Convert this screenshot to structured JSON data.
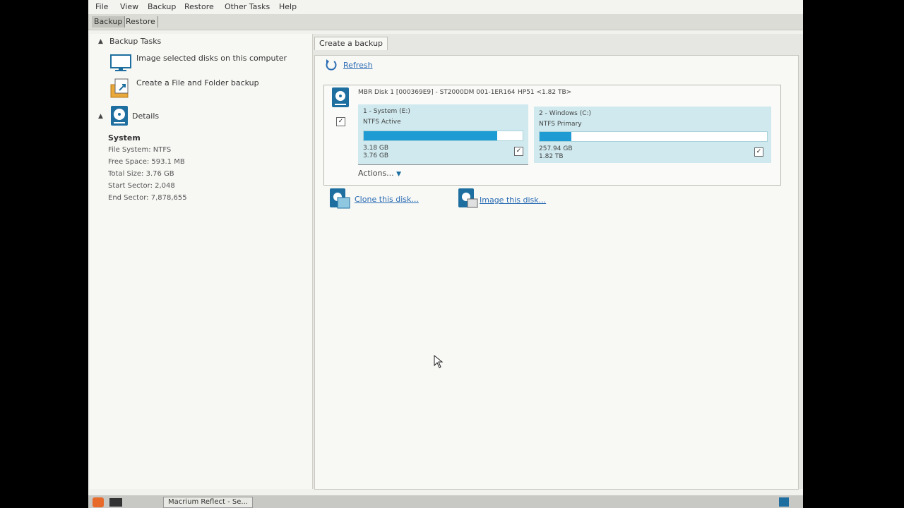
{
  "menu": [
    "File",
    "View",
    "Backup",
    "Restore",
    "Other Tasks",
    "Help"
  ],
  "top_tabs": [
    "Backup",
    "Restore"
  ],
  "left": {
    "backup_tasks_title": "Backup Tasks",
    "tasks": [
      "Image selected disks on this computer",
      "Create a File and Folder backup"
    ],
    "details_title": "Details",
    "details_name": "System",
    "details": [
      "File System: NTFS",
      "Free Space:  593.1 MB",
      "Total Size:   3.76 GB",
      "Start Sector:  2,048",
      "End Sector:    7,878,655"
    ]
  },
  "content_tab": "Create a backup",
  "refresh_label": "Refresh",
  "disk": {
    "title": "MBR Disk 1 [000369E9] - ST2000DM 001-1ER164",
    "label": "HP51  <1.82 TB>",
    "checked_mark": "✓",
    "partitions": [
      {
        "name": "1 - System (E:)",
        "type": "NTFS Active",
        "used": "3.18 GB",
        "total": "3.76 GB",
        "fill": 0.84
      },
      {
        "name": "2 - Windows (C:)",
        "type": "NTFS Primary",
        "used": "257.94 GB",
        "total": "1.82 TB",
        "fill": 0.14
      }
    ],
    "actions_label": "Actions..."
  },
  "clone_label": "Clone this disk...",
  "image_label": "Image this disk...",
  "taskbar_item": "Macrium Reflect - Se...",
  "colors": {
    "accent": "#1e9bd3",
    "partition_bg": "#cfe9ee",
    "link": "#2a6cb3"
  }
}
